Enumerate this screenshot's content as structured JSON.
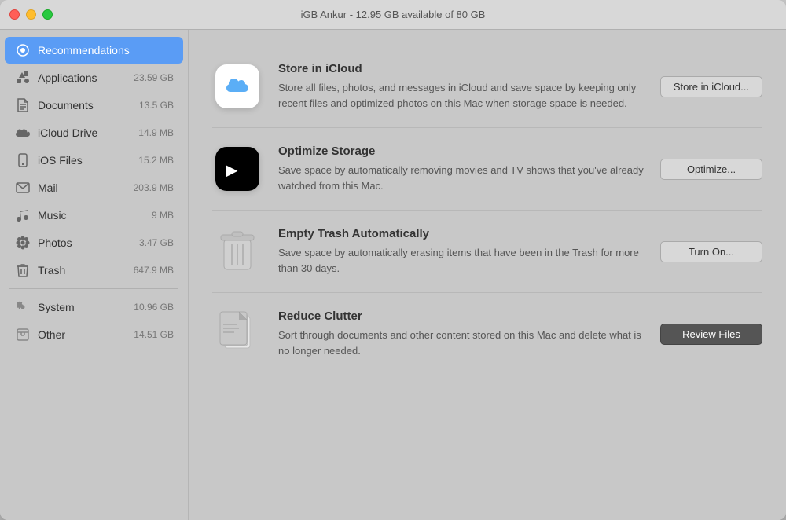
{
  "titlebar": {
    "title": "iGB Ankur - 12.95 GB available of 80 GB"
  },
  "sidebar": {
    "items": [
      {
        "id": "recommendations",
        "label": "Recommendations",
        "size": "",
        "active": true,
        "icon": "star"
      },
      {
        "id": "applications",
        "label": "Applications",
        "size": "23.59 GB",
        "active": false,
        "icon": "apps"
      },
      {
        "id": "documents",
        "label": "Documents",
        "size": "13.5 GB",
        "active": false,
        "icon": "doc"
      },
      {
        "id": "icloud-drive",
        "label": "iCloud Drive",
        "size": "14.9 MB",
        "active": false,
        "icon": "cloud"
      },
      {
        "id": "ios-files",
        "label": "iOS Files",
        "size": "15.2 MB",
        "active": false,
        "icon": "phone"
      },
      {
        "id": "mail",
        "label": "Mail",
        "size": "203.9 MB",
        "active": false,
        "icon": "mail"
      },
      {
        "id": "music",
        "label": "Music",
        "size": "9 MB",
        "active": false,
        "icon": "music"
      },
      {
        "id": "photos",
        "label": "Photos",
        "size": "3.47 GB",
        "active": false,
        "icon": "flower"
      },
      {
        "id": "trash",
        "label": "Trash",
        "size": "647.9 MB",
        "active": false,
        "icon": "trash"
      }
    ],
    "section2": [
      {
        "id": "system",
        "label": "System",
        "size": "10.96 GB",
        "icon": "gear"
      },
      {
        "id": "other",
        "label": "Other",
        "size": "14.51 GB",
        "icon": "box"
      }
    ]
  },
  "recommendations": [
    {
      "id": "icloud",
      "title": "Store in iCloud",
      "description": "Store all files, photos, and messages in iCloud and save space by keeping only recent files and optimized photos on this Mac when storage space is needed.",
      "button_label": "Store in iCloud...",
      "button_style": "normal"
    },
    {
      "id": "optimize",
      "title": "Optimize Storage",
      "description": "Save space by automatically removing movies and TV shows that you've already watched from this Mac.",
      "button_label": "Optimize...",
      "button_style": "normal"
    },
    {
      "id": "empty-trash",
      "title": "Empty Trash Automatically",
      "description": "Save space by automatically erasing items that have been in the Trash for more than 30 days.",
      "button_label": "Turn On...",
      "button_style": "normal"
    },
    {
      "id": "clutter",
      "title": "Reduce Clutter",
      "description": "Sort through documents and other content stored on this Mac and delete what is no longer needed.",
      "button_label": "Review Files",
      "button_style": "primary"
    }
  ]
}
